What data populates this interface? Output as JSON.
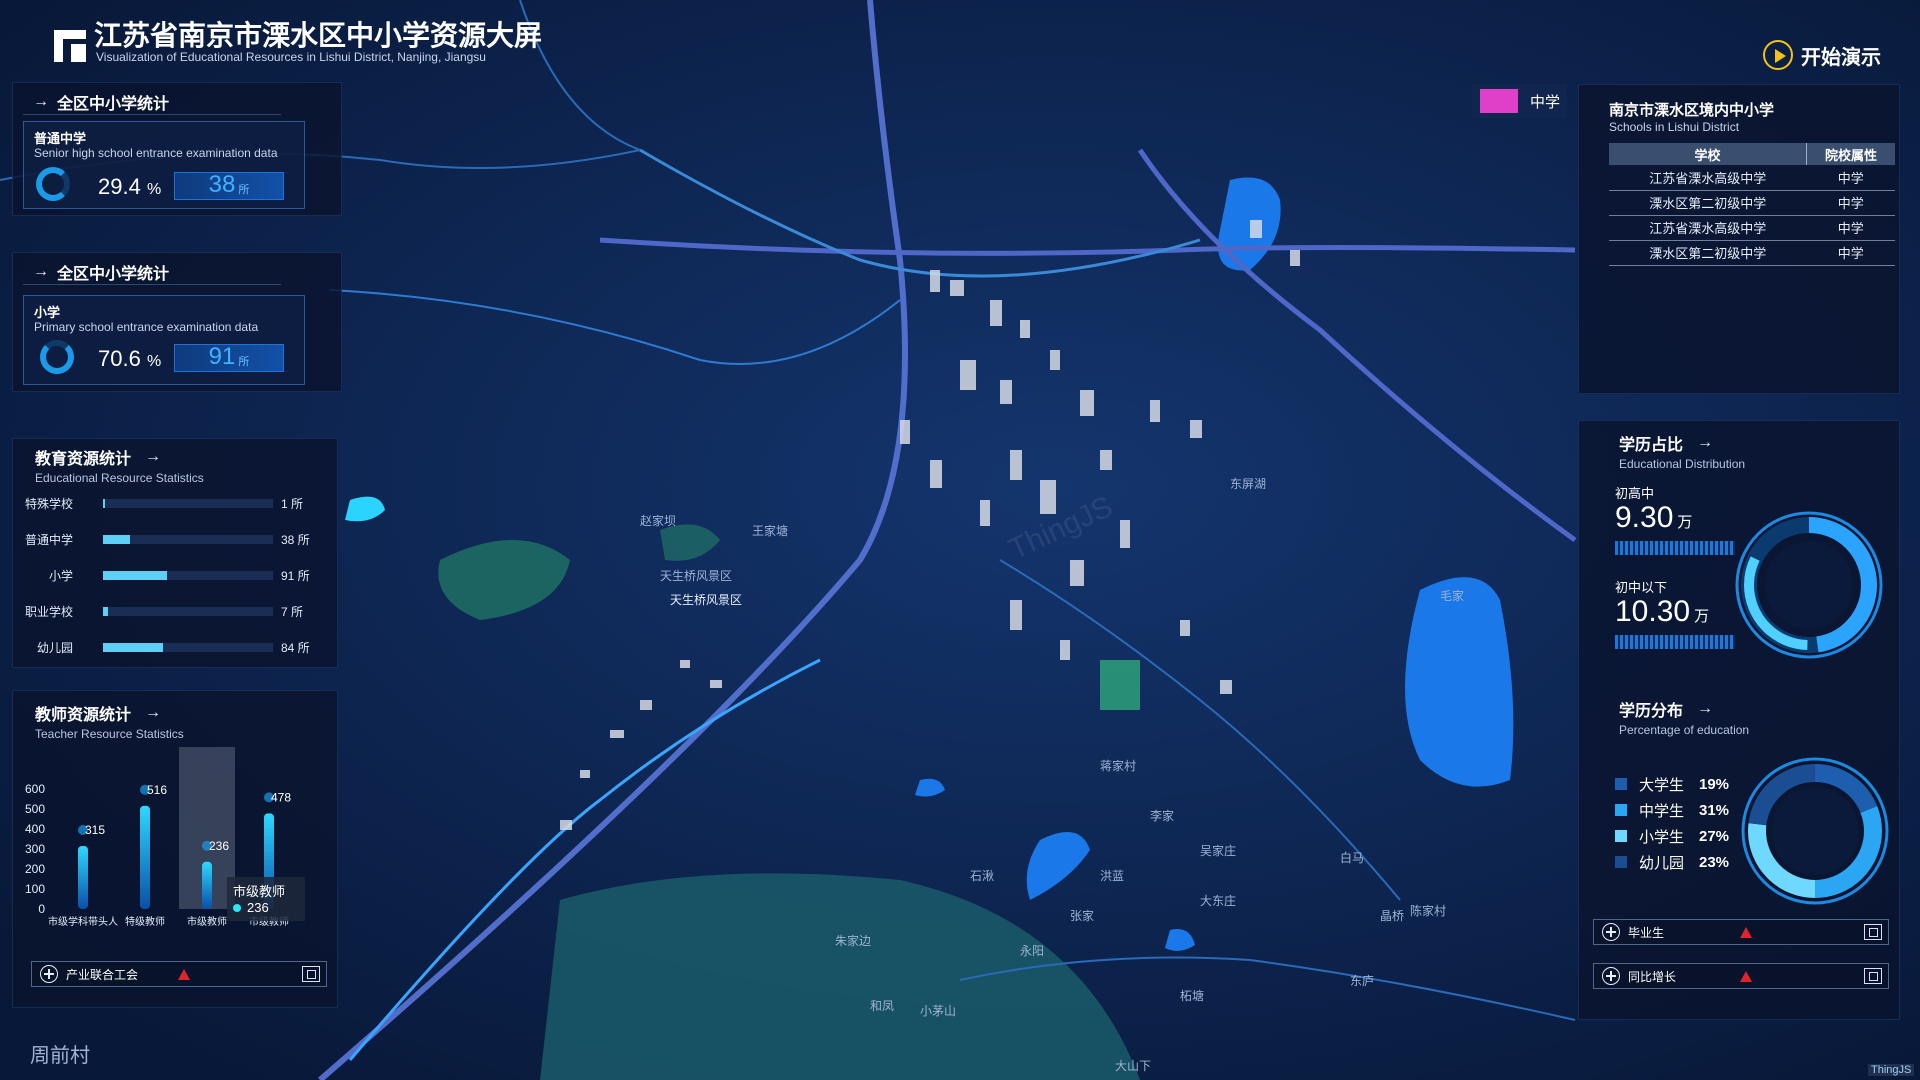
{
  "header": {
    "title": "江苏省南京市溧水区中小学资源大屏",
    "subtitle": "Visualization of Educational Resources in Lishui District, Nanjing, Jiangsu",
    "demo_label": "开始演示"
  },
  "map_legend": {
    "label": "中学",
    "color": "#e040c8"
  },
  "map_labels": [
    "天生桥风景区",
    "天生桥风景区",
    "王家塘",
    "赵家坝",
    "洪蓝",
    "李家",
    "东屏湖",
    "周前村",
    "蒋家村",
    "柘塘",
    "和凤",
    "石湫",
    "晶桥",
    "白马",
    "永阳",
    "吴家庄",
    "陈家村",
    "毛家",
    "张家",
    "朱家边",
    "大东庄",
    "小茅山",
    "大山下",
    "东庐"
  ],
  "watermark": "ThingJS",
  "brand_tag": "ThingJS",
  "left": {
    "middle_stat": {
      "header": "全区中小学统计",
      "name": "普通中学",
      "desc": "Senior high school entrance examination data",
      "pct": "29.4",
      "pct_unit": "%",
      "count": "38",
      "count_unit": "所"
    },
    "primary_stat": {
      "header": "全区中小学统计",
      "name": "小学",
      "desc": "Primary school entrance examination data",
      "pct": "70.6",
      "pct_unit": "%",
      "count": "91",
      "count_unit": "所"
    },
    "edu_resources": {
      "title": "教育资源统计",
      "subtitle": "Educational Resource Statistics",
      "rows": [
        {
          "label": "特殊学校",
          "value": 1,
          "text": "1 所"
        },
        {
          "label": "普通中学",
          "value": 38,
          "text": "38 所"
        },
        {
          "label": "小学",
          "value": 91,
          "text": "91 所"
        },
        {
          "label": "职业学校",
          "value": 7,
          "text": "7 所"
        },
        {
          "label": "幼儿园",
          "value": 84,
          "text": "84 所"
        }
      ],
      "max": 240
    },
    "teacher_resources": {
      "title": "教师资源统计",
      "subtitle": "Teacher Resource Statistics",
      "tooltip_title": "市级教师",
      "tooltip_value": "236",
      "footer_label": "产业联合工会"
    }
  },
  "right": {
    "schools": {
      "title": "南京市溧水区境内中小学",
      "subtitle": "Schools in Lishui District",
      "col_school": "学校",
      "col_attr": "院校属性",
      "rows": [
        {
          "school": "江苏省溧水高级中学",
          "attr": "中学"
        },
        {
          "school": "溧水区第二初级中学",
          "attr": "中学"
        },
        {
          "school": "江苏省溧水高级中学",
          "attr": "中学"
        },
        {
          "school": "溧水区第二初级中学",
          "attr": "中学"
        }
      ]
    },
    "edu_ratio": {
      "title": "学历占比",
      "subtitle": "Educational Distribution",
      "item1_label": "初高中",
      "item1_value": "9.30",
      "item1_unit": "万",
      "item2_label": "初中以下",
      "item2_value": "10.30",
      "item2_unit": "万"
    },
    "edu_distribution": {
      "title": "学历分布",
      "subtitle": "Percentage of education",
      "items": [
        {
          "name": "大学生",
          "pct": "19%",
          "color": "#1d5fae"
        },
        {
          "name": "中学生",
          "pct": "31%",
          "color": "#2ba6f2"
        },
        {
          "name": "小学生",
          "pct": "27%",
          "color": "#6fd8ff"
        },
        {
          "name": "幼儿园",
          "pct": "23%",
          "color": "#1a4d92"
        }
      ]
    },
    "footer1": "毕业生",
    "footer2": "同比增长"
  },
  "chart_data": {
    "type": "bar",
    "categories": [
      "市级学科带头人",
      "特级教师",
      "市级教师",
      "市级教师"
    ],
    "values": [
      315,
      516,
      236,
      478
    ],
    "ylim": [
      0,
      600
    ],
    "yticks": [
      0,
      100,
      200,
      300,
      400,
      500,
      600
    ],
    "grid": false,
    "highlight_index": 2
  }
}
